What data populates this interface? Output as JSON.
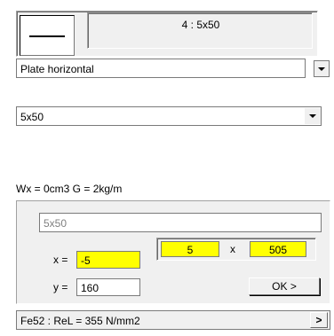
{
  "profile": {
    "designation": "4 : 5x50"
  },
  "shape_select": {
    "value": "Plate horizontal"
  },
  "size_select": {
    "value": "5x50"
  },
  "section_props": {
    "text": "Wx = 0cm3   G = 2kg/m"
  },
  "editor": {
    "name_value": "5x50",
    "x_label": "x =",
    "x_value": "-5",
    "y_label": "y =",
    "y_value": "160",
    "thickness_value": "5",
    "times_symbol": "x",
    "width_value": "505",
    "ok_label": "OK >"
  },
  "material": {
    "text": "Fe52 : ReL = 355 N/mm2",
    "arrow": ">"
  },
  "colors": {
    "panel": "#f0f0f0",
    "highlight_field": "#ffff00"
  },
  "icons": {
    "profile_preview": "horizontal-plate-line",
    "dropdown": "triangle-down"
  }
}
